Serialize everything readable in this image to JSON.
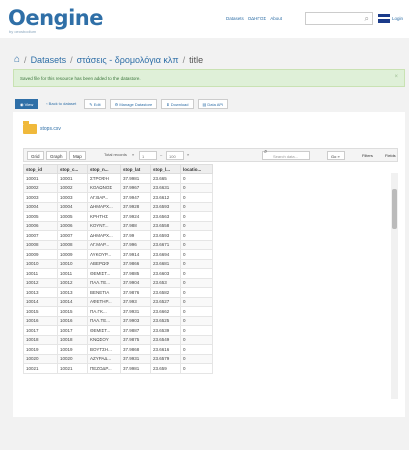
{
  "header": {
    "logo": "Oengine",
    "logo_sub": "by oeosbodium",
    "nav": [
      "Datasets",
      "ΟΔΗΓΟΣ",
      "About"
    ],
    "lang": "Login"
  },
  "breadcrumb": {
    "items": [
      "Datasets",
      "στάσεις - δρομολόγια κλπ",
      "title"
    ]
  },
  "alert": {
    "text": "Saved file for this resource has been added to the datastore.",
    "close": "×"
  },
  "toolbar": {
    "buttons": [
      "View",
      "Back to dataset",
      "Edit",
      "Manage Datastore",
      "Download",
      "Data API"
    ]
  },
  "resource": {
    "file_name": "stops.csv"
  },
  "grid": {
    "tabs": [
      "Grid",
      "Graph",
      "Map"
    ],
    "pager_label": "Total records",
    "pager_from": "1",
    "pager_to": "100",
    "search_placeholder": "Search data...",
    "go": "Go »",
    "filters": "Filters",
    "fields": "Fields",
    "columns": [
      "stop_id",
      "stop_c...",
      "stop_n...",
      "stop_lat",
      "stop_l...",
      "locatio..."
    ],
    "rows": [
      [
        "10001",
        "10001",
        "ΣΤΡΟΦΗ",
        "37.9981",
        "23.665",
        "0"
      ],
      [
        "10002",
        "10002",
        "ΚΟΛΩΝΟΣ",
        "37.9967",
        "23.6631",
        "0"
      ],
      [
        "10003",
        "10003",
        "ΑΓ.ΒΑΡ...",
        "37.9947",
        "23.6612",
        "0"
      ],
      [
        "10004",
        "10004",
        "ΔΗΜΑΡΧ...",
        "37.9928",
        "23.6593",
        "0"
      ],
      [
        "10005",
        "10005",
        "ΚΡΗΤΗΣ",
        "37.9924",
        "23.6563",
        "0"
      ],
      [
        "10006",
        "10006",
        "ΚΟΥΝΤ...",
        "37.988",
        "23.6558",
        "0"
      ],
      [
        "10007",
        "10007",
        "ΔΗΜΑΡΧ...",
        "37.99",
        "23.6593",
        "0"
      ],
      [
        "10008",
        "10008",
        "ΑΓ.ΜΑΡ...",
        "37.996",
        "23.6671",
        "0"
      ],
      [
        "10009",
        "10009",
        "ΛΥΚΟΥΡ...",
        "37.9914",
        "23.6694",
        "0"
      ],
      [
        "10010",
        "10010",
        "ΑΒΕΡΩΦ",
        "37.9866",
        "23.6681",
        "0"
      ],
      [
        "10011",
        "10011",
        "ΘΕΜΙΣΤ...",
        "37.9885",
        "23.6603",
        "0"
      ],
      [
        "10012",
        "10012",
        "ΠΑΛ.ΤΕ...",
        "37.9904",
        "23.653",
        "0"
      ],
      [
        "10013",
        "10013",
        "ΒΕΝΕΤΙΑ",
        "37.9876",
        "23.6582",
        "0"
      ],
      [
        "10014",
        "10014",
        "ΑΦΕΤΗΡ...",
        "37.993",
        "23.6527",
        "0"
      ],
      [
        "10015",
        "10015",
        "ΠΑ.ΓΚ...",
        "37.9931",
        "23.6662",
        "0"
      ],
      [
        "10016",
        "10016",
        "ΠΑΛ.ΤΕ...",
        "37.9903",
        "23.6525",
        "0"
      ],
      [
        "10017",
        "10017",
        "ΘΕΜΙΣΤ...",
        "37.9887",
        "23.6539",
        "0"
      ],
      [
        "10018",
        "10018",
        "ΚΝΩΣΟΥ",
        "37.9875",
        "23.6549",
        "0"
      ],
      [
        "10019",
        "10019",
        "ΒΟΥΤΣΗ...",
        "37.9868",
        "23.6616",
        "0"
      ],
      [
        "10020",
        "10020",
        "ΑΖΥΡΑΔ...",
        "37.9931",
        "23.6579",
        "0"
      ],
      [
        "10021",
        "10021",
        "ΠΕΖΟΔΡ...",
        "37.9981",
        "23.659",
        "0"
      ]
    ]
  }
}
